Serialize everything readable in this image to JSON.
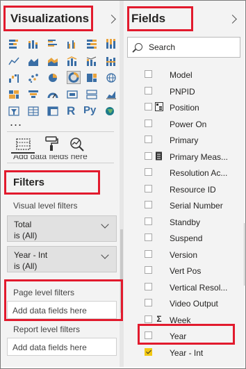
{
  "visualizations": {
    "title": "Visualizations",
    "icons": [
      "stacked-bar-chart-icon",
      "stacked-column-chart-icon",
      "clustered-bar-chart-icon",
      "clustered-column-chart-icon",
      "100-stacked-bar-chart-icon",
      "100-stacked-column-chart-icon",
      "line-chart-icon",
      "area-chart-icon",
      "stacked-area-chart-icon",
      "line-and-column-chart-icon",
      "line-and-stacked-column-chart-icon",
      "ribbon-chart-icon",
      "waterfall-chart-icon",
      "scatter-chart-icon",
      "pie-chart-icon",
      "donut-chart-icon",
      "treemap-icon",
      "map-icon",
      "filled-map-icon",
      "funnel-icon",
      "gauge-icon",
      "card-icon",
      "multi-row-card-icon",
      "kpi-icon",
      "slicer-icon",
      "table-icon",
      "matrix-icon",
      "r-script-visual-icon",
      "python-visual-icon",
      "globe-map-icon"
    ],
    "text_icons": {
      "r": "R",
      "py": "Py"
    },
    "more": "...",
    "tools": [
      "fields-well-icon",
      "format-paint-roller-icon",
      "analytics-magnifier-icon"
    ],
    "clipped_zone_text": "Add data fields here"
  },
  "filters": {
    "title": "Filters",
    "visual_level_label": "Visual level filters",
    "cards": [
      {
        "name": "Total",
        "value": "is (All)"
      },
      {
        "name": "Year - Int",
        "value": "is (All)"
      }
    ],
    "page_level_label": "Page level filters",
    "page_level_drop": "Add data fields here",
    "report_level_label": "Report level filters",
    "report_level_drop": "Add data fields here"
  },
  "fields": {
    "title": "Fields",
    "search_placeholder": "Search",
    "items": [
      {
        "label": "Model",
        "checked": false,
        "icon": ""
      },
      {
        "label": "PNPID",
        "checked": false,
        "icon": ""
      },
      {
        "label": "Position",
        "checked": false,
        "icon": "hierarchy-icon"
      },
      {
        "label": "Power On",
        "checked": false,
        "icon": ""
      },
      {
        "label": "Primary",
        "checked": false,
        "icon": ""
      },
      {
        "label": "Primary Meas...",
        "checked": false,
        "icon": "measure-table-icon"
      },
      {
        "label": "Resolution Ac...",
        "checked": false,
        "icon": ""
      },
      {
        "label": "Resource ID",
        "checked": false,
        "icon": ""
      },
      {
        "label": "Serial Number",
        "checked": false,
        "icon": ""
      },
      {
        "label": "Standby",
        "checked": false,
        "icon": ""
      },
      {
        "label": "Suspend",
        "checked": false,
        "icon": ""
      },
      {
        "label": "Version",
        "checked": false,
        "icon": ""
      },
      {
        "label": "Vert Pos",
        "checked": false,
        "icon": ""
      },
      {
        "label": "Vertical Resol...",
        "checked": false,
        "icon": ""
      },
      {
        "label": "Video Output",
        "checked": false,
        "icon": ""
      },
      {
        "label": "Week",
        "checked": false,
        "icon": "sigma-icon",
        "icon_text": "Σ"
      },
      {
        "label": "Year",
        "checked": false,
        "icon": ""
      },
      {
        "label": "Year - Int",
        "checked": true,
        "icon": ""
      }
    ]
  },
  "colors": {
    "highlight_box": "#e21a2d",
    "checked_yellow": "#f2c811",
    "pane_background": "#f3f3f3"
  }
}
